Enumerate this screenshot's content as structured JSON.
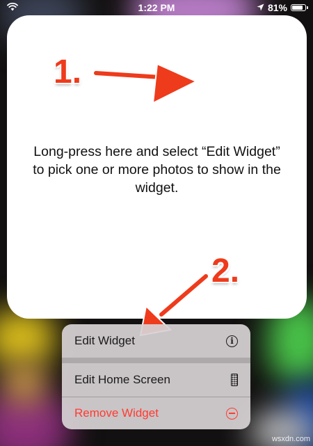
{
  "status_bar": {
    "time": "1:22 PM",
    "battery": "81%",
    "battery_level": 0.81,
    "icons": [
      "wifi-icon",
      "location-icon",
      "battery-icon"
    ]
  },
  "widget": {
    "message": "Long-press here and select “Edit Widget” to pick one or more photos to show in the widget."
  },
  "annotations": {
    "step1": "1.",
    "step2": "2.",
    "color": "#ee3b1c"
  },
  "context_menu": {
    "items": [
      {
        "label": "Edit Widget",
        "icon": "info-icon"
      },
      {
        "label": "Edit Home Screen",
        "icon": "phone-icon"
      },
      {
        "label": "Remove Widget",
        "icon": "minus-circle-icon",
        "color": "#ff3b30"
      }
    ]
  },
  "watermark": "wsxdn.com"
}
